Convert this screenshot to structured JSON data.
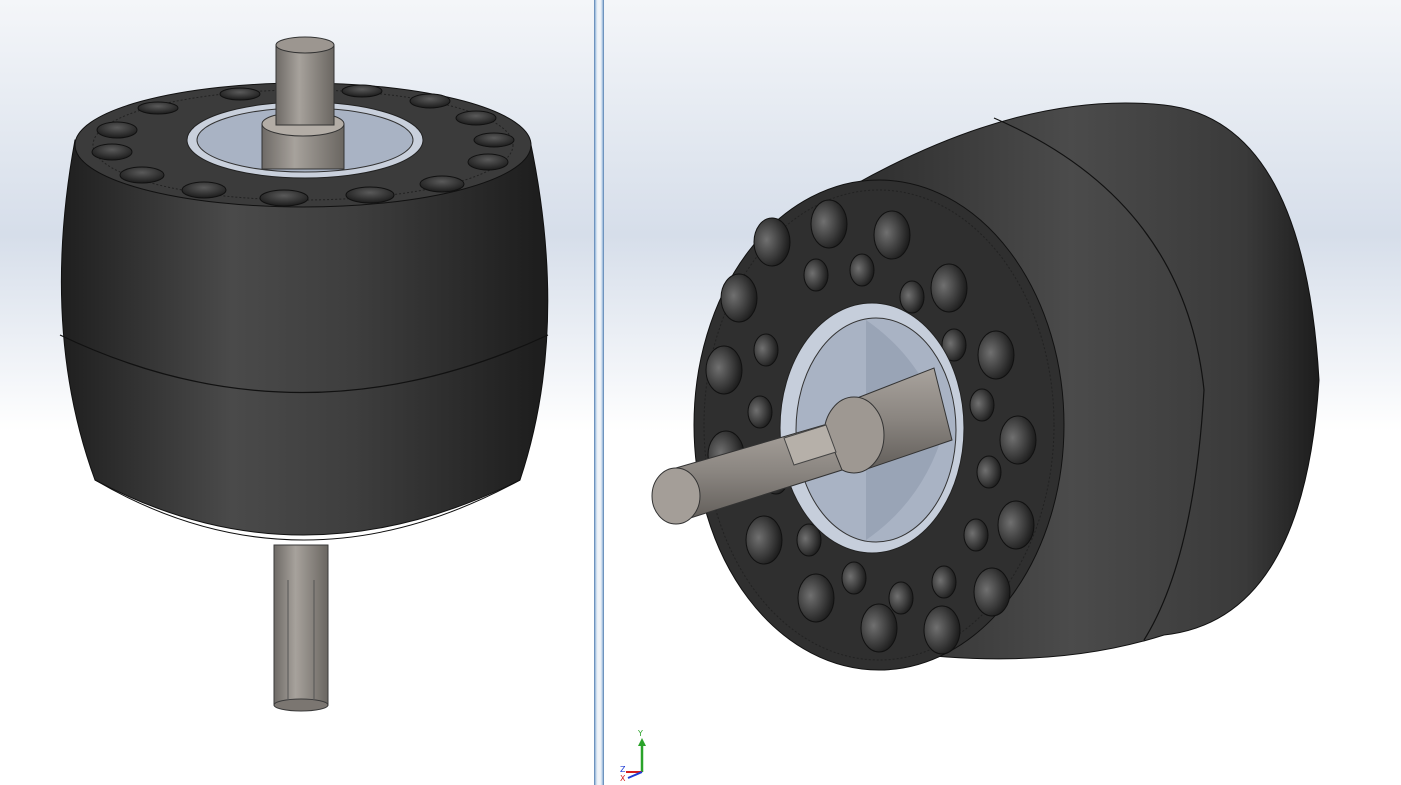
{
  "triad": {
    "x_label": "X",
    "y_label": "Y",
    "z_label": "Z",
    "x_color": "#d41e1e",
    "y_color": "#2aa32a",
    "z_color": "#1e3cd4"
  },
  "colors": {
    "wheel_body": "#3a3a3a",
    "shaft": "#8f8a85",
    "bore": "#b9c2d2",
    "splitter": "#8fb3d9"
  },
  "views": [
    {
      "name": "top-isometric-view",
      "hole_count": 16
    },
    {
      "name": "side-isometric-view",
      "hole_count": 28
    }
  ]
}
